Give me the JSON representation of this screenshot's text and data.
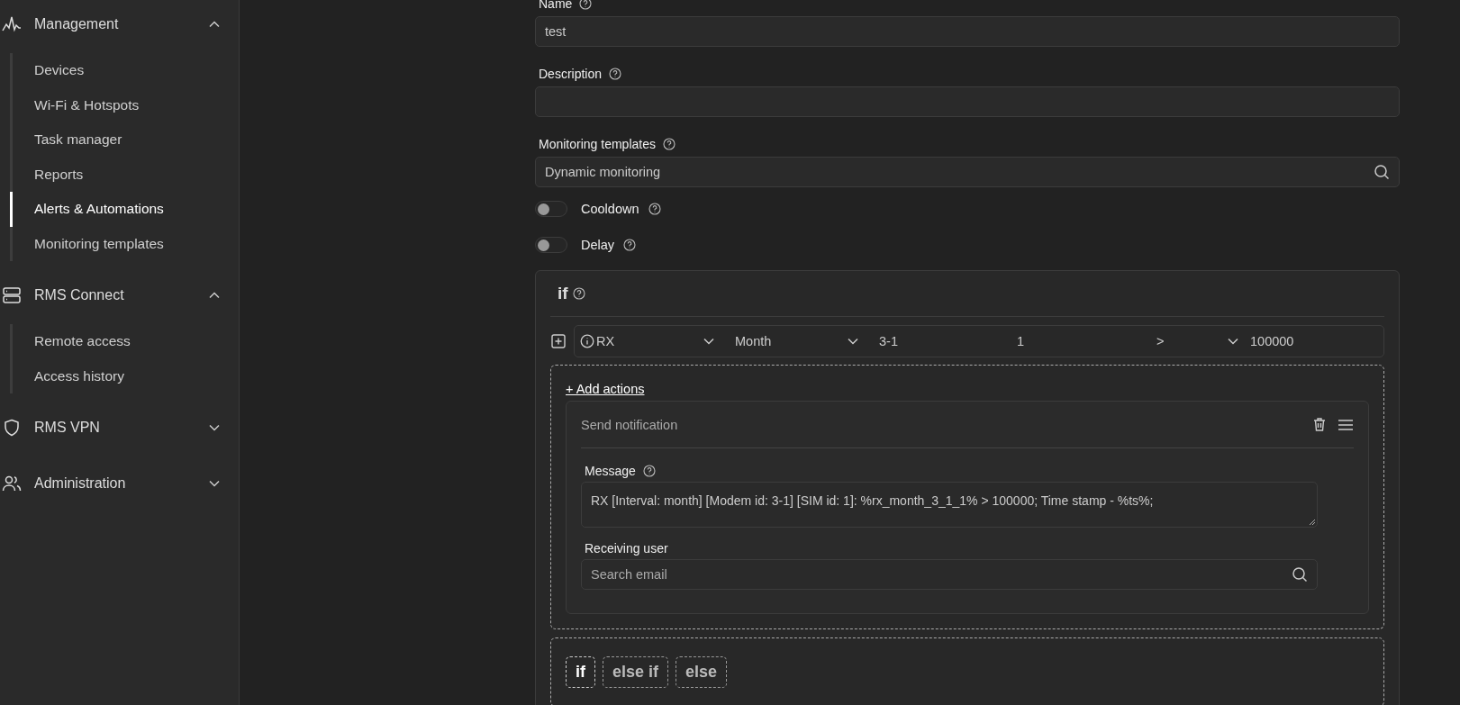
{
  "sidebar": {
    "groups": [
      {
        "label": "Management",
        "expanded": true,
        "items": [
          {
            "label": "Devices",
            "selected": false
          },
          {
            "label": "Wi-Fi & Hotspots",
            "selected": false
          },
          {
            "label": "Task manager",
            "selected": false
          },
          {
            "label": "Reports",
            "selected": false
          },
          {
            "label": "Alerts & Automations",
            "selected": true
          },
          {
            "label": "Monitoring templates",
            "selected": false
          }
        ]
      },
      {
        "label": "RMS Connect",
        "expanded": true,
        "items": [
          {
            "label": "Remote access",
            "selected": false
          },
          {
            "label": "Access history",
            "selected": false
          }
        ]
      },
      {
        "label": "RMS VPN",
        "expanded": false
      },
      {
        "label": "Administration",
        "expanded": false
      }
    ]
  },
  "form": {
    "name": {
      "label": "Name",
      "value": "test"
    },
    "description": {
      "label": "Description"
    },
    "monitoring_template": {
      "label": "Monitoring templates",
      "value": "Dynamic monitoring"
    },
    "toggles": [
      {
        "label": "Cooldown",
        "on": false
      },
      {
        "label": "Delay",
        "on": false
      }
    ],
    "rule": {
      "title": "if",
      "condition": {
        "metric": "RX",
        "interval": "Month",
        "modem": "3-1",
        "sim": "1",
        "operator": ">",
        "threshold": "100000"
      },
      "add_actions": "+ Add actions",
      "action": {
        "title": "Send notification",
        "message": {
          "label": "Message",
          "value": "RX [Interval: month] [Modem id: 3-1] [SIM id: 1]: %rx_month_3_1_1% > 100000; Time stamp - %ts%;"
        },
        "receiving_user": {
          "label": "Receiving user",
          "placeholder": "Search email"
        }
      },
      "branch_buttons": [
        {
          "label": "if",
          "disabled": false
        },
        {
          "label": "else if",
          "disabled": true
        },
        {
          "label": "else",
          "disabled": true
        }
      ]
    }
  }
}
